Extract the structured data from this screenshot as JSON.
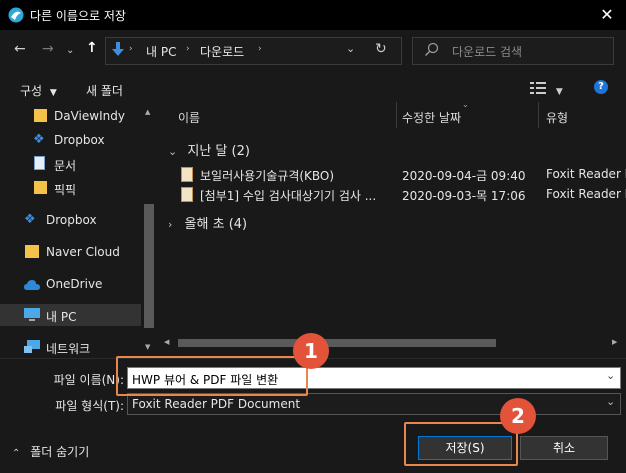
{
  "window": {
    "title": "다른 이름으로 저장"
  },
  "nav": {
    "breadcrumb": [
      "내 PC",
      "다운로드"
    ],
    "search_placeholder": "다운로드 검색"
  },
  "toolbar": {
    "organize": "구성",
    "new_folder": "새 폴더"
  },
  "sidebar": {
    "items": [
      {
        "label": "DaViewIndy"
      },
      {
        "label": "Dropbox"
      },
      {
        "label": "문서"
      },
      {
        "label": "픽픽"
      },
      {
        "label": "Dropbox"
      },
      {
        "label": "Naver Cloud"
      },
      {
        "label": "OneDrive"
      },
      {
        "label": "내 PC"
      },
      {
        "label": "네트워크"
      }
    ]
  },
  "columns": [
    "이름",
    "수정한 날짜",
    "유형"
  ],
  "groups": [
    {
      "label": "지난 달 (2)",
      "files": [
        {
          "name": "보일러사용기술규격(KBO)",
          "date": "2020-09-04-금 09:40",
          "type": "Foxit Reader PDF"
        },
        {
          "name": "[첨부1] 수입 검사대상기기 검사 ...",
          "date": "2020-09-03-목 17:06",
          "type": "Foxit Reader PDF"
        }
      ]
    },
    {
      "label": "올해 초 (4)"
    }
  ],
  "form": {
    "filename_label": "파일 이름(N):",
    "filename_value": "HWP 뷰어 & PDF 파일 변환",
    "filetype_label": "파일 형식(T):",
    "filetype_value": "Foxit Reader PDF Document"
  },
  "footer": {
    "hide_folders": "폴더 숨기기",
    "save": "저장(S)",
    "cancel": "취소"
  },
  "annotations": {
    "badge1": "1",
    "badge2": "2"
  },
  "colors": {
    "accent": "#0078d7",
    "highlight": "#e8864f",
    "badge": "#e2533a"
  }
}
